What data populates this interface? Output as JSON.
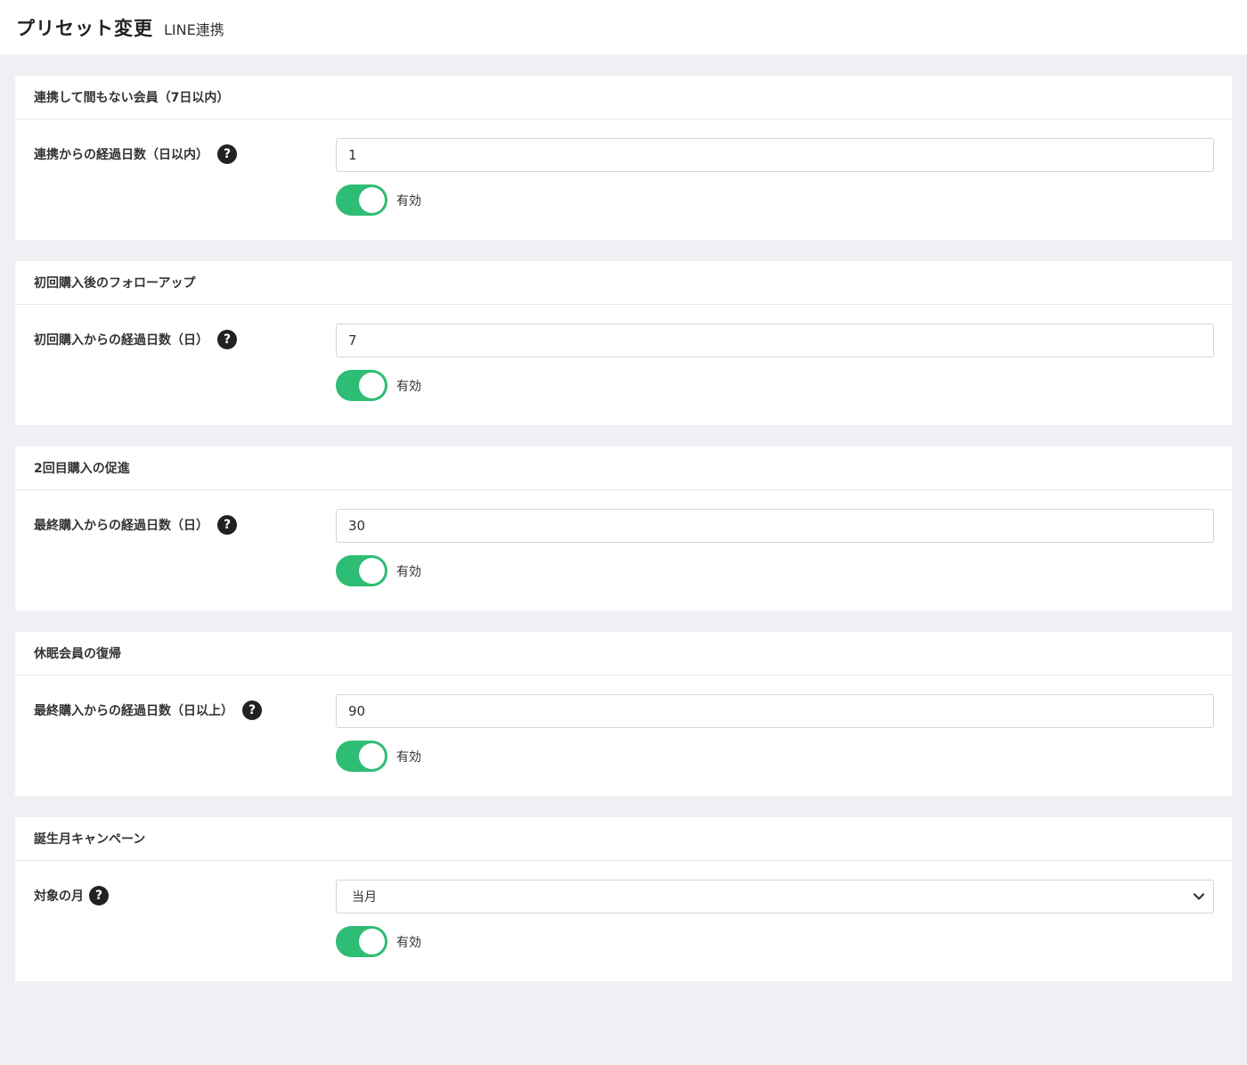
{
  "header": {
    "title": "プリセット変更",
    "subtitle": "LINE連携"
  },
  "sections": [
    {
      "title": "連携して間もない会員（7日以内）",
      "field_label": "連携からの経過日数（日以内）",
      "value": "1",
      "toggle_label": "有効",
      "toggle_on": true
    },
    {
      "title": "初回購入後のフォローアップ",
      "field_label": "初回購入からの経過日数（日）",
      "value": "7",
      "toggle_label": "有効",
      "toggle_on": true
    },
    {
      "title": "2回目購入の促進",
      "field_label": "最終購入からの経過日数（日）",
      "value": "30",
      "toggle_label": "有効",
      "toggle_on": true
    },
    {
      "title": "休眠会員の復帰",
      "field_label": "最終購入からの経過日数（日以上）",
      "value": "90",
      "toggle_label": "有効",
      "toggle_on": true
    },
    {
      "title": "誕生月キャンペーン",
      "field_label": "対象の月",
      "select_value": "当月",
      "toggle_label": "有効",
      "toggle_on": true
    }
  ],
  "icons": {
    "help": "question-circle-icon",
    "dropdown": "chevron-down-icon"
  },
  "colors": {
    "toggle_on": "#2ebd74",
    "background": "#eef0f4"
  }
}
